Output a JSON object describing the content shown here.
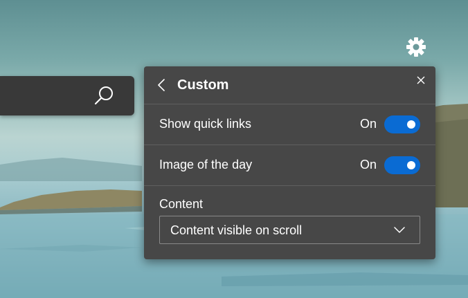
{
  "search": {
    "value": "",
    "button_icon": "search-icon"
  },
  "settings": {
    "icon": "gear-icon"
  },
  "panel": {
    "title": "Custom",
    "back_icon": "chevron-left-icon",
    "close_icon": "close-icon",
    "rows": [
      {
        "label": "Show quick links",
        "state": "On",
        "enabled": true
      },
      {
        "label": "Image of the day",
        "state": "On",
        "enabled": true
      }
    ],
    "content": {
      "label": "Content",
      "selected": "Content visible on scroll",
      "chevron_icon": "chevron-down-icon"
    }
  },
  "colors": {
    "panel_bg": "#474747",
    "toggle_on": "#0a6bd3",
    "search_bg": "#393939"
  }
}
